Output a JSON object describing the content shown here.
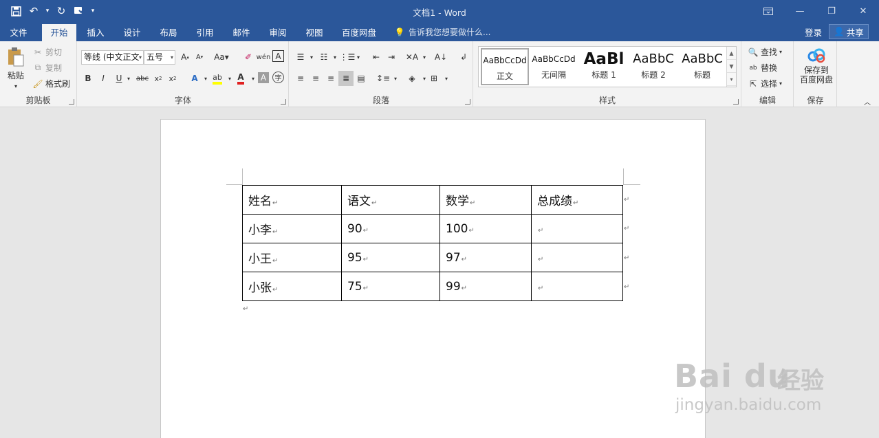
{
  "window": {
    "title": "文档1 - Word"
  },
  "tabs": [
    "文件",
    "开始",
    "插入",
    "设计",
    "布局",
    "引用",
    "邮件",
    "审阅",
    "视图",
    "百度网盘"
  ],
  "active_tab": "开始",
  "tellme": "告诉我您想要做什么...",
  "account": {
    "login": "登录",
    "share": "共享"
  },
  "clipboard": {
    "paste": "粘贴",
    "cut": "剪切",
    "copy": "复制",
    "format_painter": "格式刷",
    "label": "剪贴板"
  },
  "font": {
    "name": "等线 (中文正文",
    "size": "五号",
    "label": "字体"
  },
  "paragraph": {
    "label": "段落"
  },
  "styles": {
    "label": "样式",
    "items": [
      {
        "sample": "AaBbCcDd",
        "name": "正文"
      },
      {
        "sample": "AaBbCcDd",
        "name": "无间隔"
      },
      {
        "sample": "AaBl",
        "name": "标题 1"
      },
      {
        "sample": "AaBbC",
        "name": "标题 2"
      },
      {
        "sample": "AaBbC",
        "name": "标题"
      }
    ]
  },
  "editing": {
    "find": "查找",
    "replace": "替换",
    "select": "选择",
    "label": "编辑"
  },
  "save": {
    "button": "保存到\n百度网盘",
    "label": "保存"
  },
  "table": {
    "headers": [
      "姓名",
      "语文",
      "数学",
      "总成绩"
    ],
    "rows": [
      [
        "小李",
        "90",
        "100",
        ""
      ],
      [
        "小王",
        "95",
        "97",
        ""
      ],
      [
        "小张",
        "75",
        "99",
        ""
      ]
    ]
  },
  "watermark": {
    "brand": "Bai du",
    "cn": "经验",
    "url": "jingyan.baidu.com"
  },
  "colors": {
    "titlebar": "#2b579a",
    "ribbon": "#f3f3f3",
    "page": "#ffffff"
  }
}
